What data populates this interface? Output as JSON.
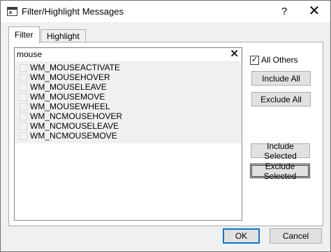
{
  "window": {
    "title": "Filter/Highlight Messages",
    "help_label": "?",
    "close_label": "✕"
  },
  "tabs": [
    {
      "label": "Filter",
      "active": true
    },
    {
      "label": "Highlight",
      "active": false
    }
  ],
  "search": {
    "value": "mouse",
    "clear_label": "✕"
  },
  "messages": [
    {
      "label": "WM_MOUSEACTIVATE",
      "checked": false
    },
    {
      "label": "WM_MOUSEHOVER",
      "checked": false
    },
    {
      "label": "WM_MOUSELEAVE",
      "checked": false
    },
    {
      "label": "WM_MOUSEMOVE",
      "checked": false
    },
    {
      "label": "WM_MOUSEWHEEL",
      "checked": false
    },
    {
      "label": "WM_NCMOUSEHOVER",
      "checked": false
    },
    {
      "label": "WM_NCMOUSELEAVE",
      "checked": false
    },
    {
      "label": "WM_NCMOUSEMOVE",
      "checked": false
    }
  ],
  "all_others": {
    "label": "All Others",
    "checked": true,
    "check_mark": "✓"
  },
  "buttons": {
    "include_all": "Include All",
    "exclude_all": "Exclude All",
    "include_selected": "Include Selected",
    "exclude_selected": "Exclude Selected",
    "ok": "OK",
    "cancel": "Cancel"
  }
}
